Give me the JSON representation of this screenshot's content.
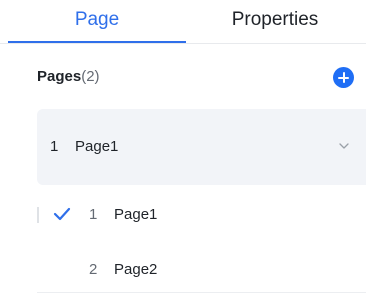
{
  "tabs": [
    {
      "label": "Page",
      "active": true
    },
    {
      "label": "Properties",
      "active": false
    }
  ],
  "pages_header": {
    "title": "Pages",
    "count": "(2)",
    "add_icon": "plus-circle-icon"
  },
  "current_page": {
    "number": "1",
    "name": "Page1",
    "icon": "chevron-down-icon"
  },
  "page_list": [
    {
      "number": "1",
      "name": "Page1",
      "selected": true,
      "icon": "check-icon"
    },
    {
      "number": "2",
      "name": "Page2",
      "selected": false
    }
  ],
  "colors": {
    "accent": "#2f6fea",
    "add_button": "#1f6ef5",
    "selector_bg": "#f2f4f8"
  }
}
